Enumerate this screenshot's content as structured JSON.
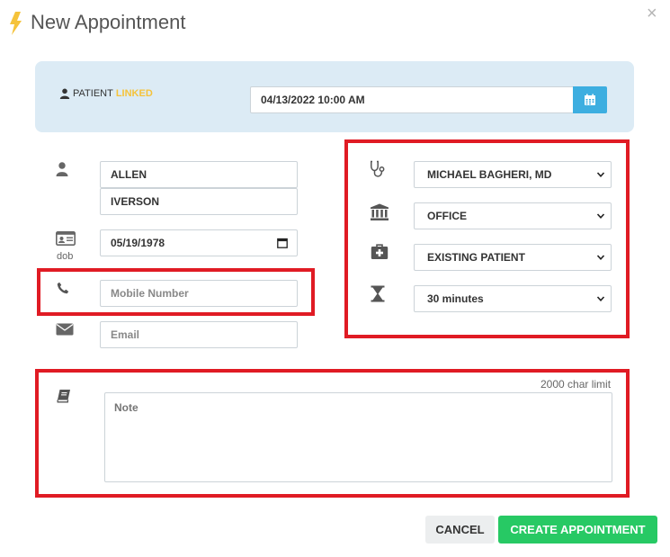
{
  "dialog": {
    "title": "New Appointment",
    "close_glyph": "×"
  },
  "banner": {
    "patient_label": "PATIENT",
    "linked_label": "LINKED",
    "datetime_value": "04/13/2022 10:00 AM"
  },
  "patient": {
    "first_name": "ALLEN",
    "last_name": "IVERSON",
    "dob_label": "dob",
    "dob_value": "05/19/1978",
    "mobile_placeholder": "Mobile Number",
    "email_placeholder": "Email"
  },
  "appointment": {
    "provider": "MICHAEL BAGHERI, MD",
    "location": "OFFICE",
    "visit_type": "EXISTING PATIENT",
    "duration": "30 minutes"
  },
  "notes": {
    "char_limit": "2000 char limit",
    "placeholder": "Note"
  },
  "actions": {
    "cancel_label": "CANCEL",
    "create_label": "CREATE APPOINTMENT"
  },
  "colors": {
    "accent_blue": "#3daee0",
    "banner_bg": "#dcebf5",
    "linked_yellow": "#f5c33b",
    "create_green": "#27c964",
    "highlight_red": "#e01b24"
  },
  "icons": {
    "title": "lightning-bolt-icon",
    "calendar": "calendar-icon",
    "user": "user-icon",
    "id_card": "id-card-icon",
    "phone": "phone-icon",
    "envelope": "envelope-icon",
    "stethoscope": "stethoscope-icon",
    "building": "bank-building-icon",
    "medical_kit": "medical-kit-icon",
    "hourglass": "hourglass-icon",
    "note": "book-icon"
  }
}
